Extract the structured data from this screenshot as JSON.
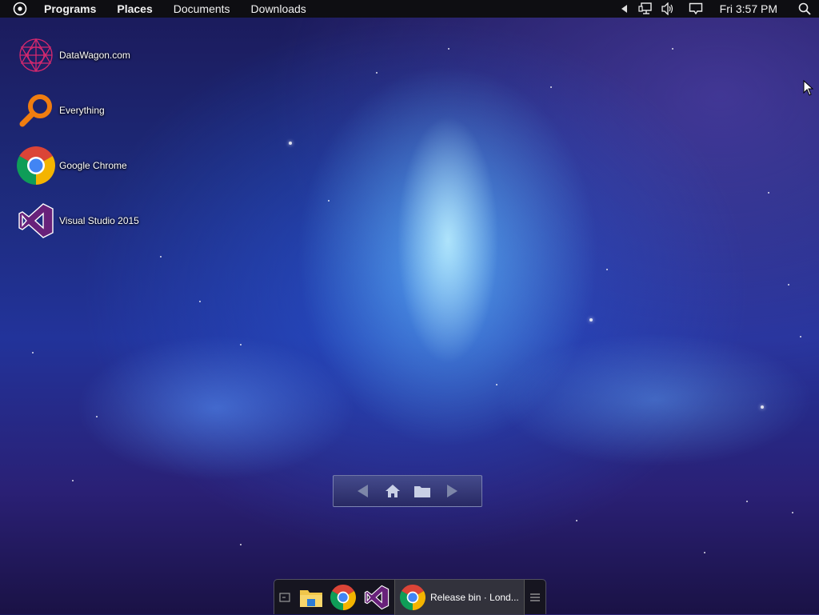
{
  "topbar": {
    "menu": [
      "Programs",
      "Places",
      "Documents",
      "Downloads"
    ],
    "clock": "Fri 3:57 PM",
    "icons": [
      "start-orb-icon",
      "tray-collapse-arrow-icon",
      "network-icon",
      "volume-icon",
      "notification-icon",
      "search-icon"
    ]
  },
  "desktop": {
    "icons": [
      {
        "label": "DataWagon.com",
        "icon": "datawagon-icon"
      },
      {
        "label": "Everything",
        "icon": "everything-search-icon"
      },
      {
        "label": "Google Chrome",
        "icon": "chrome-icon"
      },
      {
        "label": "Visual Studio 2015",
        "icon": "visual-studio-icon"
      }
    ]
  },
  "nav_widget": {
    "icons": [
      "back-arrow-icon",
      "home-icon",
      "folder-icon",
      "forward-arrow-icon"
    ]
  },
  "dock": {
    "icons": [
      "show-desktop-icon",
      "file-explorer-icon",
      "chrome-icon",
      "visual-studio-icon"
    ],
    "task_label": "Release bin · Lond...",
    "menu_icon": "dock-menu-icon"
  },
  "colors": {
    "topbar": "#0e0e12",
    "vs_purple": "#68217a",
    "everything_orange": "#f07d10",
    "chrome_red": "#db4437",
    "chrome_green": "#0f9d58",
    "chrome_yellow": "#f4b400",
    "chrome_blue": "#4285f4"
  }
}
